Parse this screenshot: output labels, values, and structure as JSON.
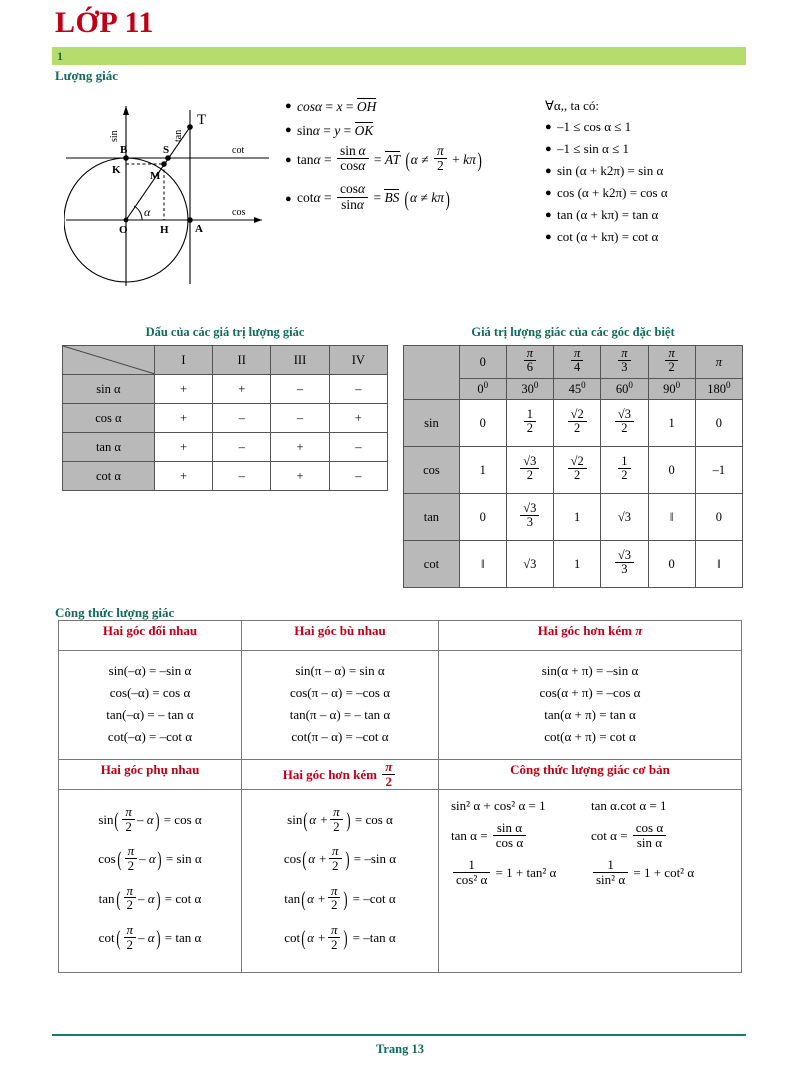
{
  "header": {
    "title": "LỚP 11",
    "section_number": "1",
    "section_title": "Lượng giác",
    "colors": {
      "title": "#c00018",
      "bar": "#b5dd6e",
      "section": "#0f6b5c"
    }
  },
  "diagram": {
    "name": "unit-circle",
    "axis_labels": {
      "sin": "sin",
      "cos": "cos",
      "tan": "tan",
      "cot": "cot"
    },
    "points": [
      "O",
      "A",
      "B",
      "H",
      "K",
      "M",
      "S",
      "T"
    ],
    "angle_label": "α"
  },
  "definitions": {
    "items": [
      {
        "lhs": "cos α",
        "rhs": "x",
        "segment": "OH"
      },
      {
        "lhs": "sin α",
        "rhs": "y",
        "segment": "OK"
      },
      {
        "lhs": "tan α",
        "num": "sin α",
        "den": "cos α",
        "segment": "AT",
        "cond_pre": "α ≠",
        "cond_num": "π",
        "cond_den": "2",
        "cond_post": "+ kπ"
      },
      {
        "lhs": "cot α",
        "num": "cos α",
        "den": "sin α",
        "segment": "BS",
        "cond": "α ≠ kπ"
      }
    ]
  },
  "properties": {
    "heading": "∀α,, ta có:",
    "items": [
      "–1 ≤ cos α ≤ 1",
      "–1 ≤ sin α ≤ 1",
      "sin (α + k2π) = sin α",
      "cos (α + k2π) = cos α",
      "tan (α + kπ) = tan α",
      "cot (α + kπ) = cot α"
    ]
  },
  "sign_table": {
    "caption": "Dấu của các giá trị lượng giác",
    "columns": [
      "I",
      "II",
      "III",
      "IV"
    ],
    "rows": [
      {
        "label": "sin α",
        "values": [
          "+",
          "+",
          "–",
          "–"
        ]
      },
      {
        "label": "cos α",
        "values": [
          "+",
          "–",
          "–",
          "+"
        ]
      },
      {
        "label": "tan α",
        "values": [
          "+",
          "–",
          "+",
          "–"
        ]
      },
      {
        "label": "cot α",
        "values": [
          "+",
          "–",
          "+",
          "–"
        ]
      }
    ]
  },
  "special_table": {
    "caption": "Giá trị lượng giác của các góc đặc biệt",
    "radians": [
      {
        "whole": "0"
      },
      {
        "num": "π",
        "den": "6"
      },
      {
        "num": "π",
        "den": "4"
      },
      {
        "num": "π",
        "den": "3"
      },
      {
        "num": "π",
        "den": "2"
      },
      {
        "whole": "π"
      }
    ],
    "degrees": [
      "0",
      "30",
      "45",
      "60",
      "90",
      "180"
    ],
    "rows": [
      {
        "label": "sin",
        "values": [
          {
            "whole": "0"
          },
          {
            "num": "1",
            "den": "2"
          },
          {
            "num": "√2",
            "den": "2"
          },
          {
            "num": "√3",
            "den": "2"
          },
          {
            "whole": "1"
          },
          {
            "whole": "0"
          }
        ]
      },
      {
        "label": "cos",
        "values": [
          {
            "whole": "1"
          },
          {
            "num": "√3",
            "den": "2"
          },
          {
            "num": "√2",
            "den": "2"
          },
          {
            "num": "1",
            "den": "2"
          },
          {
            "whole": "0"
          },
          {
            "whole": "–1"
          }
        ]
      },
      {
        "label": "tan",
        "values": [
          {
            "whole": "0"
          },
          {
            "num": "√3",
            "den": "3"
          },
          {
            "whole": "1"
          },
          {
            "whole": "√3"
          },
          {
            "whole": "‖"
          },
          {
            "whole": "0"
          }
        ]
      },
      {
        "label": "cot",
        "values": [
          {
            "whole": "‖"
          },
          {
            "whole": "√3"
          },
          {
            "whole": "1"
          },
          {
            "num": "√3",
            "den": "3"
          },
          {
            "whole": "0"
          },
          {
            "whole": "‖"
          }
        ]
      }
    ]
  },
  "formulas": {
    "section_title": "Công thức lượng giác",
    "opposite": {
      "title": "Hai góc đối nhau",
      "lines": [
        "sin(–α) = –sin α",
        "cos(–α) = cos α",
        "tan(–α) = – tan α",
        "cot(–α) = –cot α"
      ]
    },
    "supplementary": {
      "title": "Hai góc bù nhau",
      "lines": [
        "sin(π – α) = sin α",
        "cos(π – α) = –cos α",
        "tan(π – α) = – tan α",
        "cot(π – α) = –cot α"
      ]
    },
    "differ_pi": {
      "title_text": "Hai góc hơn kém",
      "title_symbol": "π",
      "lines": [
        "sin(α + π) = –sin α",
        "cos(α + π) = –cos α",
        "tan(α + π) = tan α",
        "cot(α + π) = cot α"
      ]
    },
    "complementary": {
      "title": "Hai góc phụ nhau",
      "lines": [
        {
          "fn": "sin",
          "inner_left": "",
          "num": "π",
          "den": "2",
          "inner_right": "– α",
          "rhs": "cos α"
        },
        {
          "fn": "cos",
          "inner_left": "",
          "num": "π",
          "den": "2",
          "inner_right": "– α",
          "rhs": "sin α"
        },
        {
          "fn": "tan",
          "inner_left": "",
          "num": "π",
          "den": "2",
          "inner_right": "– α",
          "rhs": "cot α"
        },
        {
          "fn": "cot",
          "inner_left": "",
          "num": "π",
          "den": "2",
          "inner_right": "– α",
          "rhs": "tan α"
        }
      ]
    },
    "differ_half_pi": {
      "title_text": "Hai góc hơn kém",
      "title_num": "π",
      "title_den": "2",
      "lines": [
        {
          "fn": "sin",
          "inner_left": "α +",
          "num": "π",
          "den": "2",
          "inner_right": "",
          "rhs": "cos α"
        },
        {
          "fn": "cos",
          "inner_left": "α +",
          "num": "π",
          "den": "2",
          "inner_right": "",
          "rhs": "–sin α"
        },
        {
          "fn": "tan",
          "inner_left": "α +",
          "num": "π",
          "den": "2",
          "inner_right": "",
          "rhs": "–cot α"
        },
        {
          "fn": "cot",
          "inner_left": "α +",
          "num": "π",
          "den": "2",
          "inner_right": "",
          "rhs": "–tan α"
        }
      ]
    },
    "basic": {
      "title": "Công thức lượng giác cơ bản",
      "row1_left": "sin² α + cos² α = 1",
      "row1_right": "tan α.cot α = 1",
      "row2_left": {
        "lhs": "tan α =",
        "num": "sin α",
        "den": "cos α"
      },
      "row2_right": {
        "lhs": "cot α =",
        "num": "cos α",
        "den": "sin α"
      },
      "row3_left": {
        "num": "1",
        "den": "cos² α",
        "rhs": "= 1 + tan² α"
      },
      "row3_right": {
        "num": "1",
        "den": "sin² α",
        "rhs": "= 1 + cot² α"
      }
    }
  },
  "footer": {
    "page_label": "Trang 13"
  }
}
